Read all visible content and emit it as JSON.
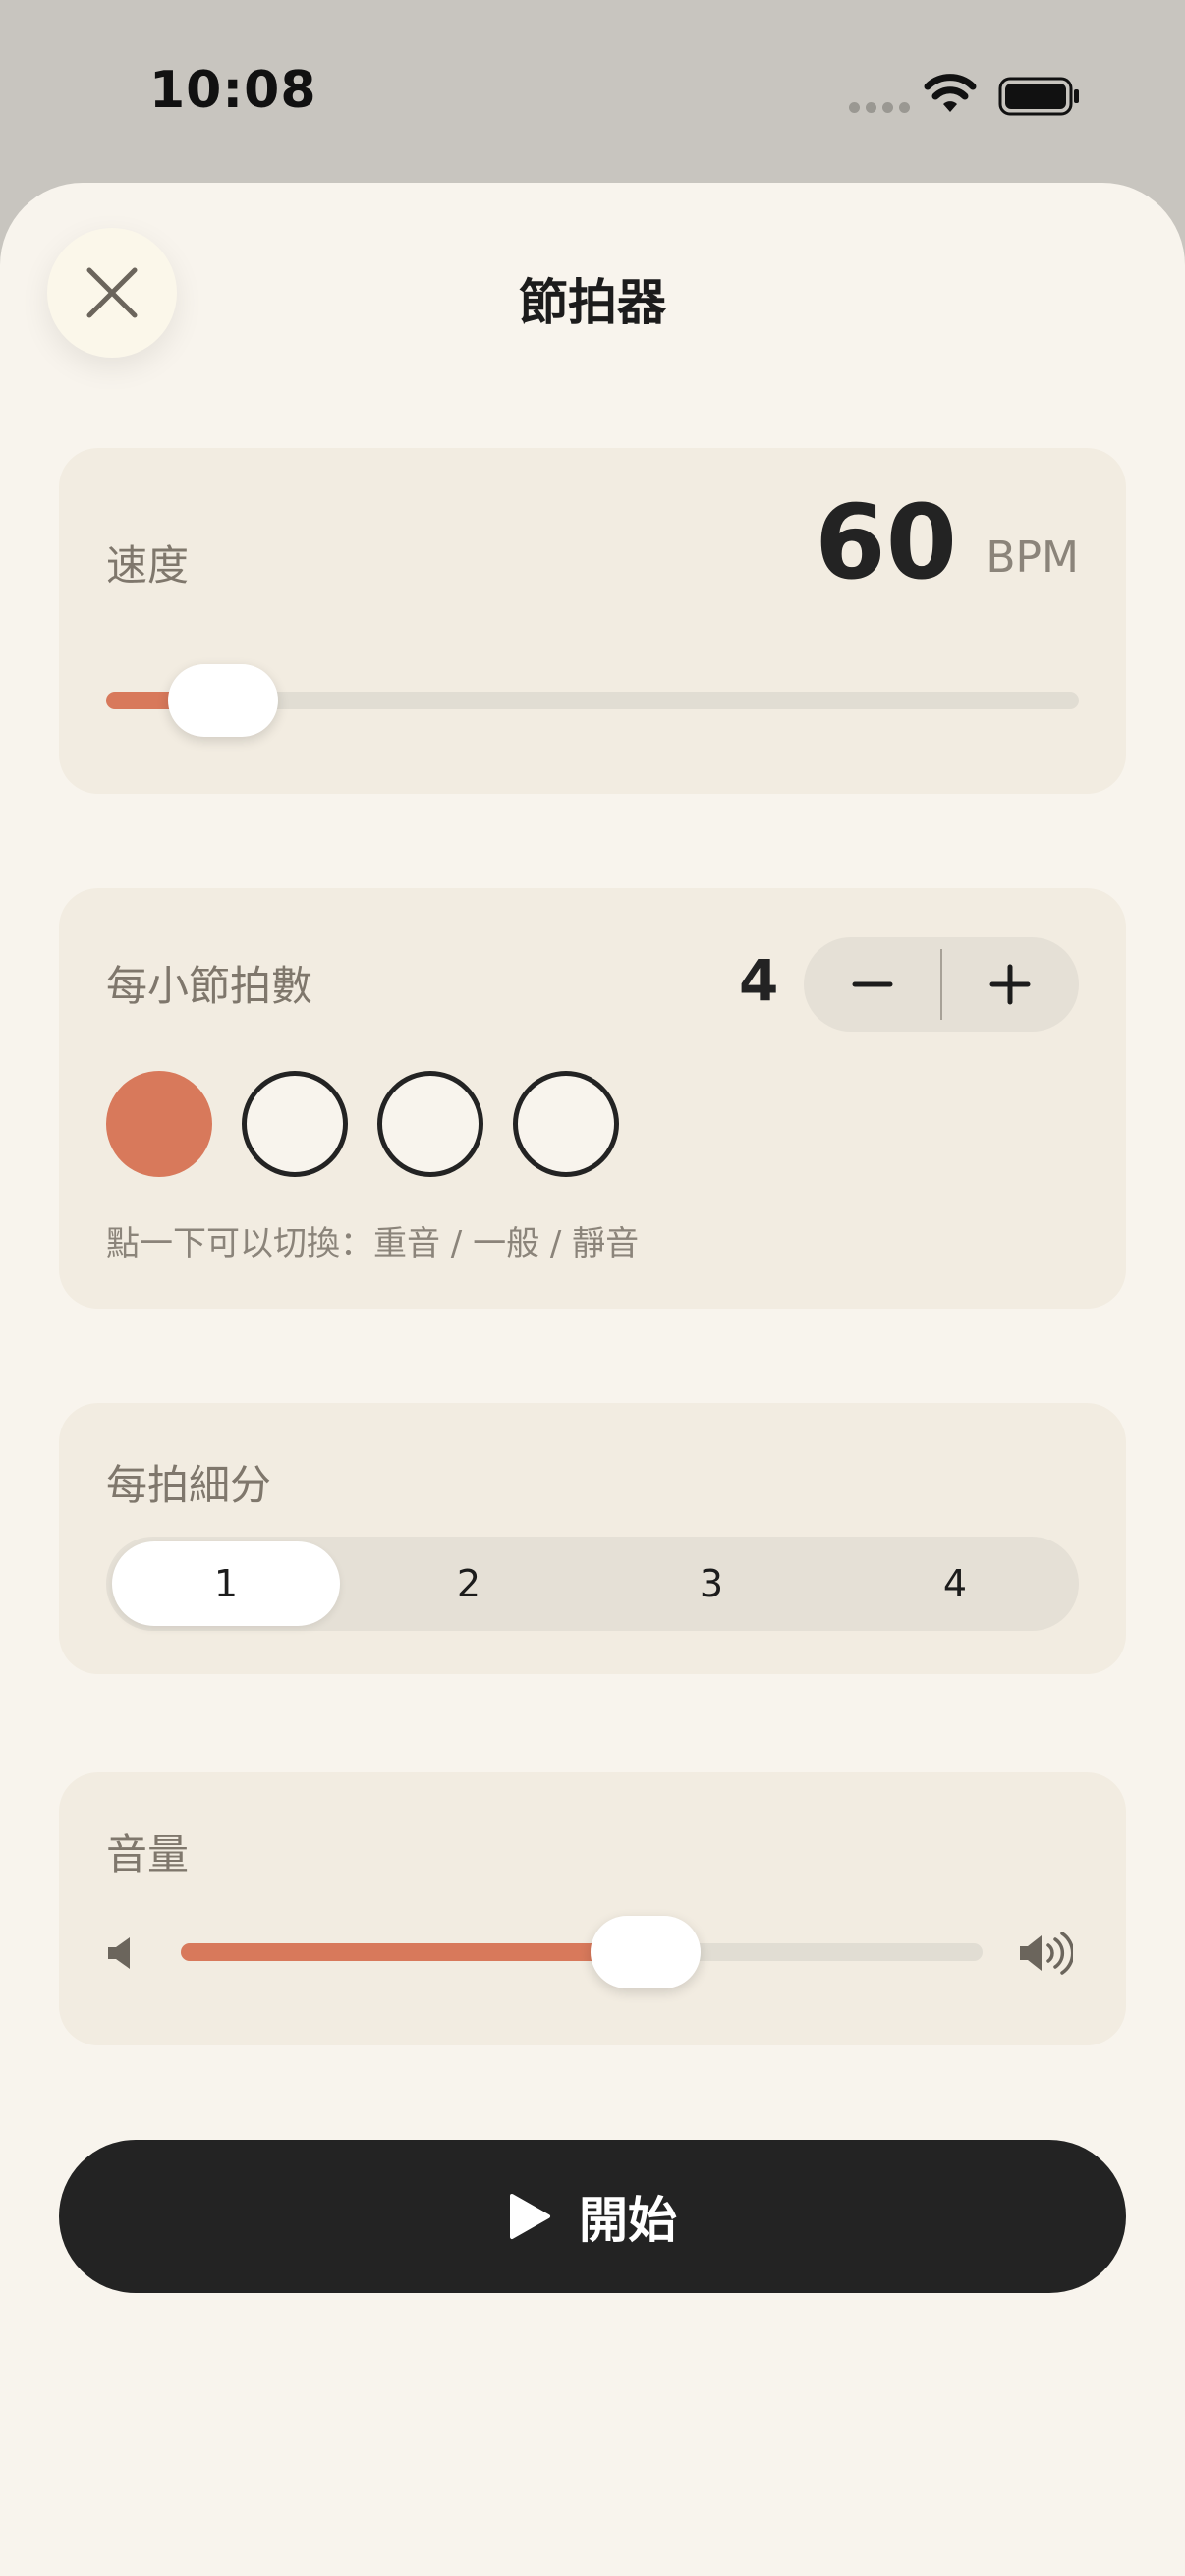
{
  "status_bar": {
    "time": "10:08"
  },
  "header": {
    "title": "節拍器",
    "close_icon": "close-icon"
  },
  "tempo": {
    "label": "速度",
    "value": "60",
    "unit": "BPM",
    "slider_fraction": 0.12
  },
  "beats": {
    "label": "每小節拍數",
    "count": "4",
    "decrement_icon": "minus-icon",
    "increment_icon": "plus-icon",
    "states": [
      "accent",
      "normal",
      "normal",
      "normal"
    ],
    "hint": "點一下可以切換：重音 / 一般 / 靜音"
  },
  "subdivision": {
    "label": "每拍細分",
    "options": [
      "1",
      "2",
      "3",
      "4"
    ],
    "selected": "1"
  },
  "volume": {
    "label": "音量",
    "slider_fraction": 0.58
  },
  "start": {
    "label": "開始",
    "icon": "play-icon"
  },
  "colors": {
    "accent": "#d8795b",
    "background": "#f8f4ed",
    "card": "#f2ece1",
    "button_dark": "#232323"
  }
}
